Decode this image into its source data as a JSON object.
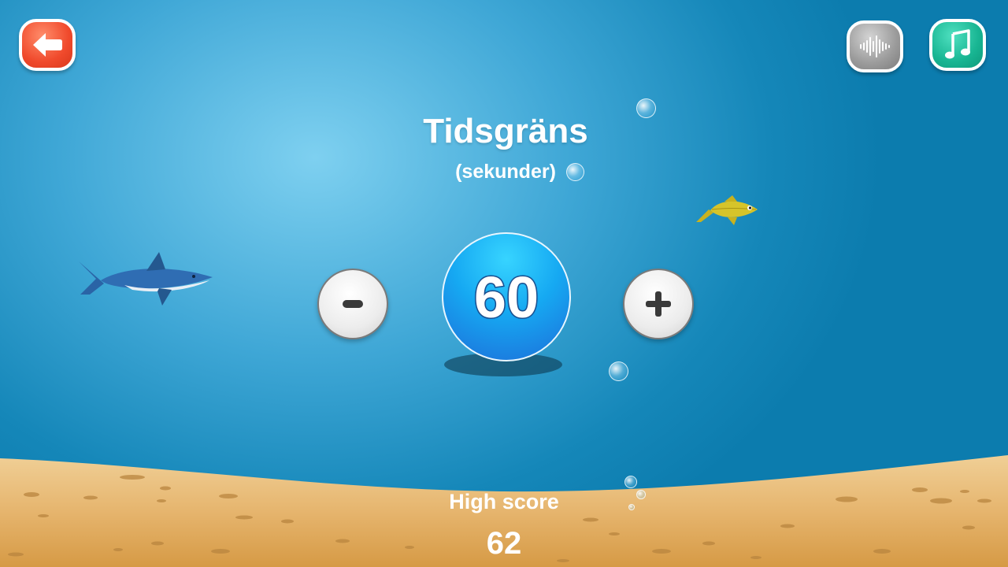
{
  "settings": {
    "title": "Tidsgräns",
    "subtitle": "(sekunder)",
    "time_limit": "60"
  },
  "high_score": {
    "label": "High score",
    "value": "62"
  },
  "buttons": {
    "back_icon": "arrow-left-icon",
    "sound_icon": "sound-wave-icon",
    "music_icon": "music-note-icon",
    "minus_icon": "minus-icon",
    "plus_icon": "plus-icon"
  },
  "colors": {
    "back_button": "#f04a2c",
    "sound_button": "#9b9b9b",
    "music_button": "#18b592",
    "value_ball": "#16a9f2",
    "sand": "#e6b56e"
  }
}
